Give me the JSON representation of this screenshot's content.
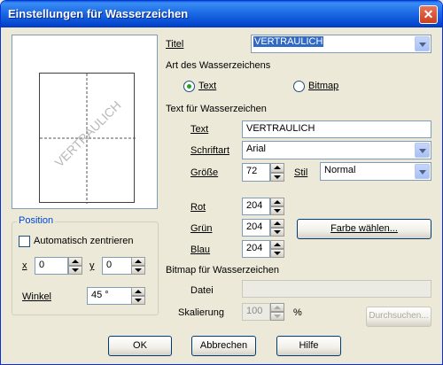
{
  "window": {
    "title": "Einstellungen für Wasserzeichen"
  },
  "preview": {
    "watermark_text": "VERTRAULICH"
  },
  "position_group": {
    "title": "Position",
    "auto_center_label": "Automatisch zentrieren",
    "x_label": "x",
    "x_value": "0",
    "y_label": "y",
    "y_value": "0",
    "angle_label": "Winkel",
    "angle_value": "45 °"
  },
  "title_field": {
    "label": "Titel",
    "value": "VERTRAULICH"
  },
  "type_section": {
    "heading": "Art des Wasserzeichens",
    "options": [
      {
        "label": "Text",
        "checked": true
      },
      {
        "label": "Bitmap",
        "checked": false
      }
    ]
  },
  "text_section": {
    "heading": "Text für Wasserzeichen",
    "text_label": "Text",
    "text_value": "VERTRAULICH",
    "font_label": "Schriftart",
    "font_value": "Arial",
    "size_label": "Größe",
    "size_value": "72",
    "style_label": "Stil",
    "style_value": "Normal"
  },
  "color_section": {
    "red_label": "Rot",
    "red_value": "204",
    "green_label": "Grün",
    "green_value": "204",
    "blue_label": "Blau",
    "blue_value": "204",
    "choose_color_button": "Farbe wählen..."
  },
  "bitmap_section": {
    "heading": "Bitmap für Wasserzeichen",
    "file_label": "Datei",
    "file_value": "",
    "scale_label": "Skalierung",
    "scale_value": "100",
    "scale_unit": "%",
    "browse_button": "Durchsuchen..."
  },
  "buttons": {
    "ok": "OK",
    "cancel": "Abbrechen",
    "help": "Hilfe"
  },
  "colors": {
    "titlebar": "#0548cf",
    "group_title": "#0046d5",
    "face": "#ece9d8"
  }
}
